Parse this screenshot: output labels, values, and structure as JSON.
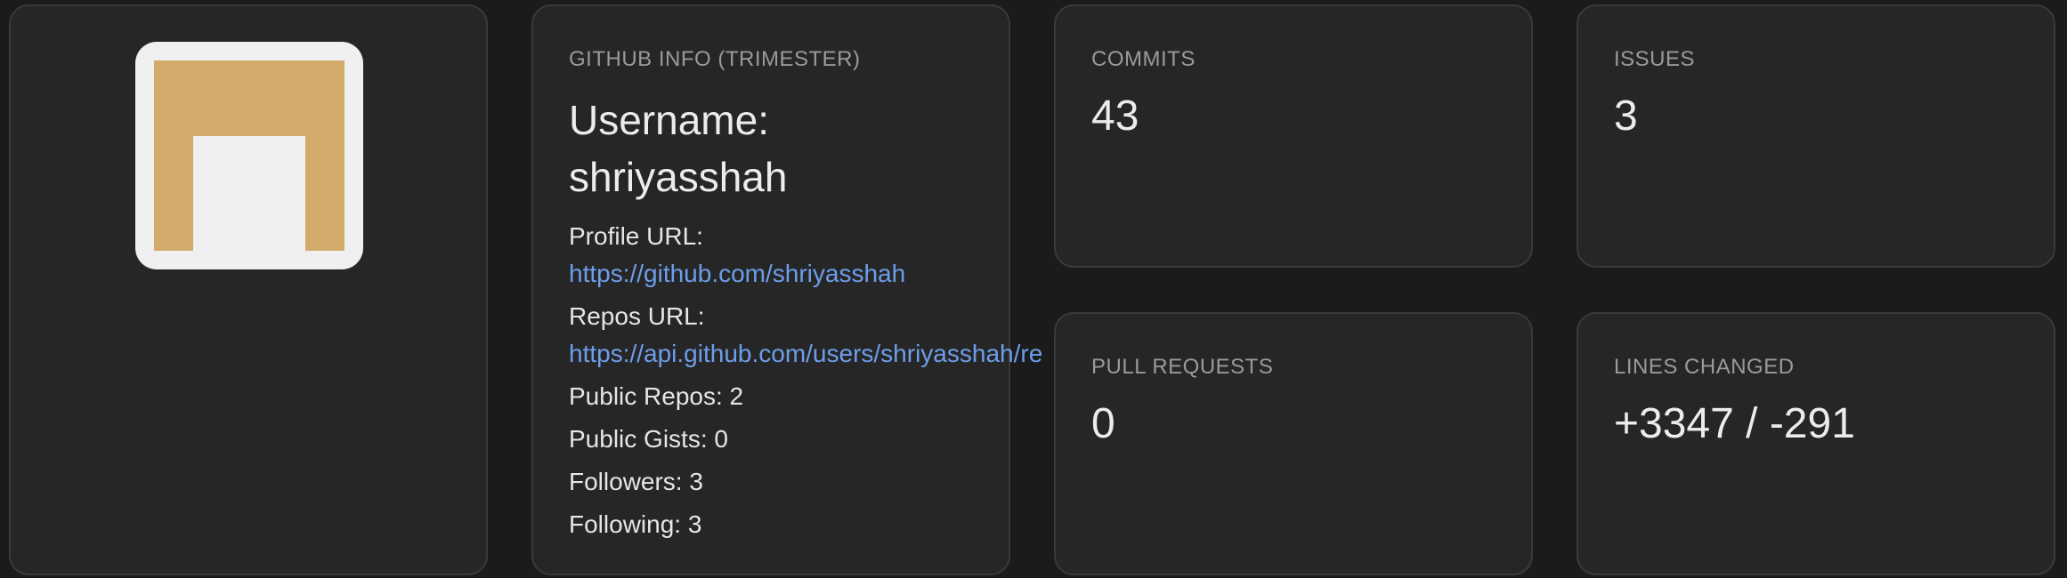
{
  "avatar": {
    "icon": "identicon",
    "colors": {
      "fill": "#d2ab6b",
      "background": "#f0f0f0"
    }
  },
  "github_info": {
    "heading": "GITHUB INFO (TRIMESTER)",
    "username_label": "Username:",
    "username": "shriyasshah",
    "profile_url_label": "Profile URL:",
    "profile_url": "https://github.com/shriyasshah",
    "repos_url_label": "Repos URL:",
    "repos_url": "https://api.github.com/users/shriyasshah/re",
    "public_repos": "Public Repos: 2",
    "public_gists": "Public Gists: 0",
    "followers": "Followers: 3",
    "following": "Following: 3"
  },
  "stats": {
    "commits": {
      "label": "COMMITS",
      "value": "43"
    },
    "issues": {
      "label": "ISSUES",
      "value": "3"
    },
    "pull_requests": {
      "label": "PULL REQUESTS",
      "value": "0"
    },
    "lines_changed": {
      "label": "LINES CHANGED",
      "value": "+3347 / -291"
    }
  },
  "colors": {
    "link": "#6d9eeb",
    "card": "#262626",
    "background": "#1b1b1b"
  }
}
